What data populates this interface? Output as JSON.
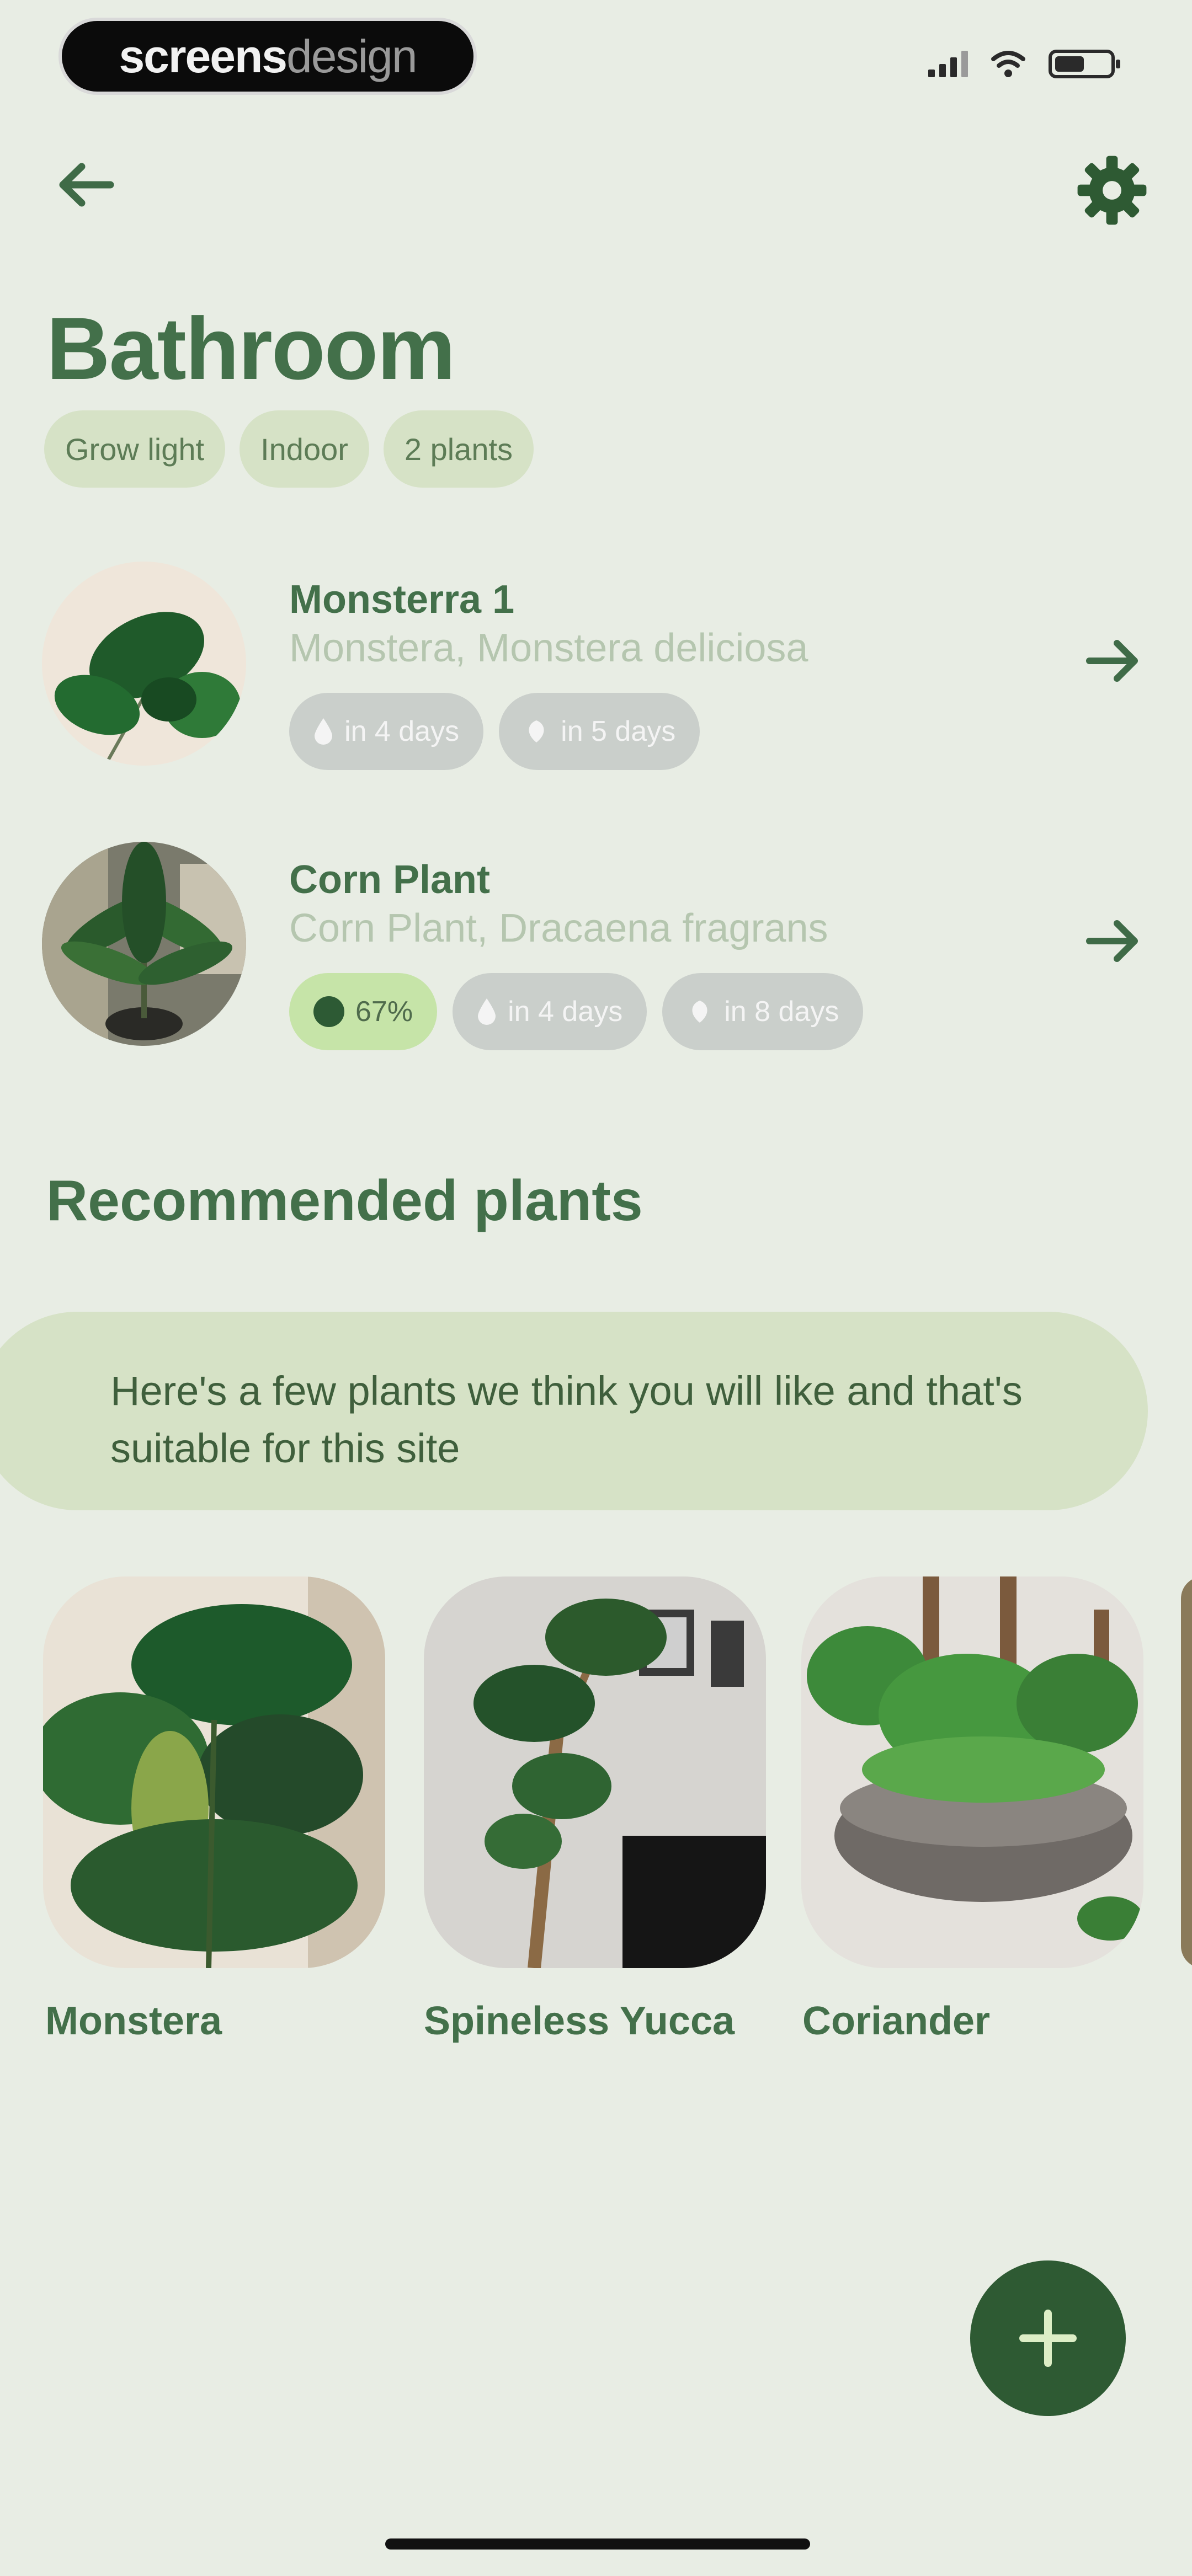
{
  "status_bar": {
    "brand_primary": "screens",
    "brand_secondary": "design"
  },
  "nav": {
    "back_icon": "arrow-left-icon",
    "settings_icon": "gear-icon"
  },
  "room": {
    "title": "Bathroom",
    "tags": [
      "Grow light",
      "Indoor",
      "2 plants"
    ]
  },
  "plants": [
    {
      "name": "Monsterra 1",
      "subtitle": "Monstera, Monstera deliciosa",
      "chips": [
        {
          "icon": "water-drop-icon",
          "label": "in 4 days"
        },
        {
          "icon": "fertilizer-icon",
          "label": "in 5 days"
        }
      ]
    },
    {
      "name": "Corn Plant",
      "subtitle": "Corn Plant, Dracaena fragrans",
      "health": "67%",
      "chips": [
        {
          "icon": "water-drop-icon",
          "label": "in 4 days"
        },
        {
          "icon": "fertilizer-icon",
          "label": "in 8 days"
        }
      ]
    }
  ],
  "recommended": {
    "title": "Recommended plants",
    "description": "Here's a few plants we think you will like and that's suitable for this site",
    "items": [
      "Monstera",
      "Spineless Yucca",
      "Coriander"
    ]
  },
  "colors": {
    "background": "#E8EDE4",
    "primary_green": "#43704A",
    "tag_bg": "#D6E2C6",
    "fab": "#2E5A33",
    "health_chip": "#C6E4A8"
  }
}
